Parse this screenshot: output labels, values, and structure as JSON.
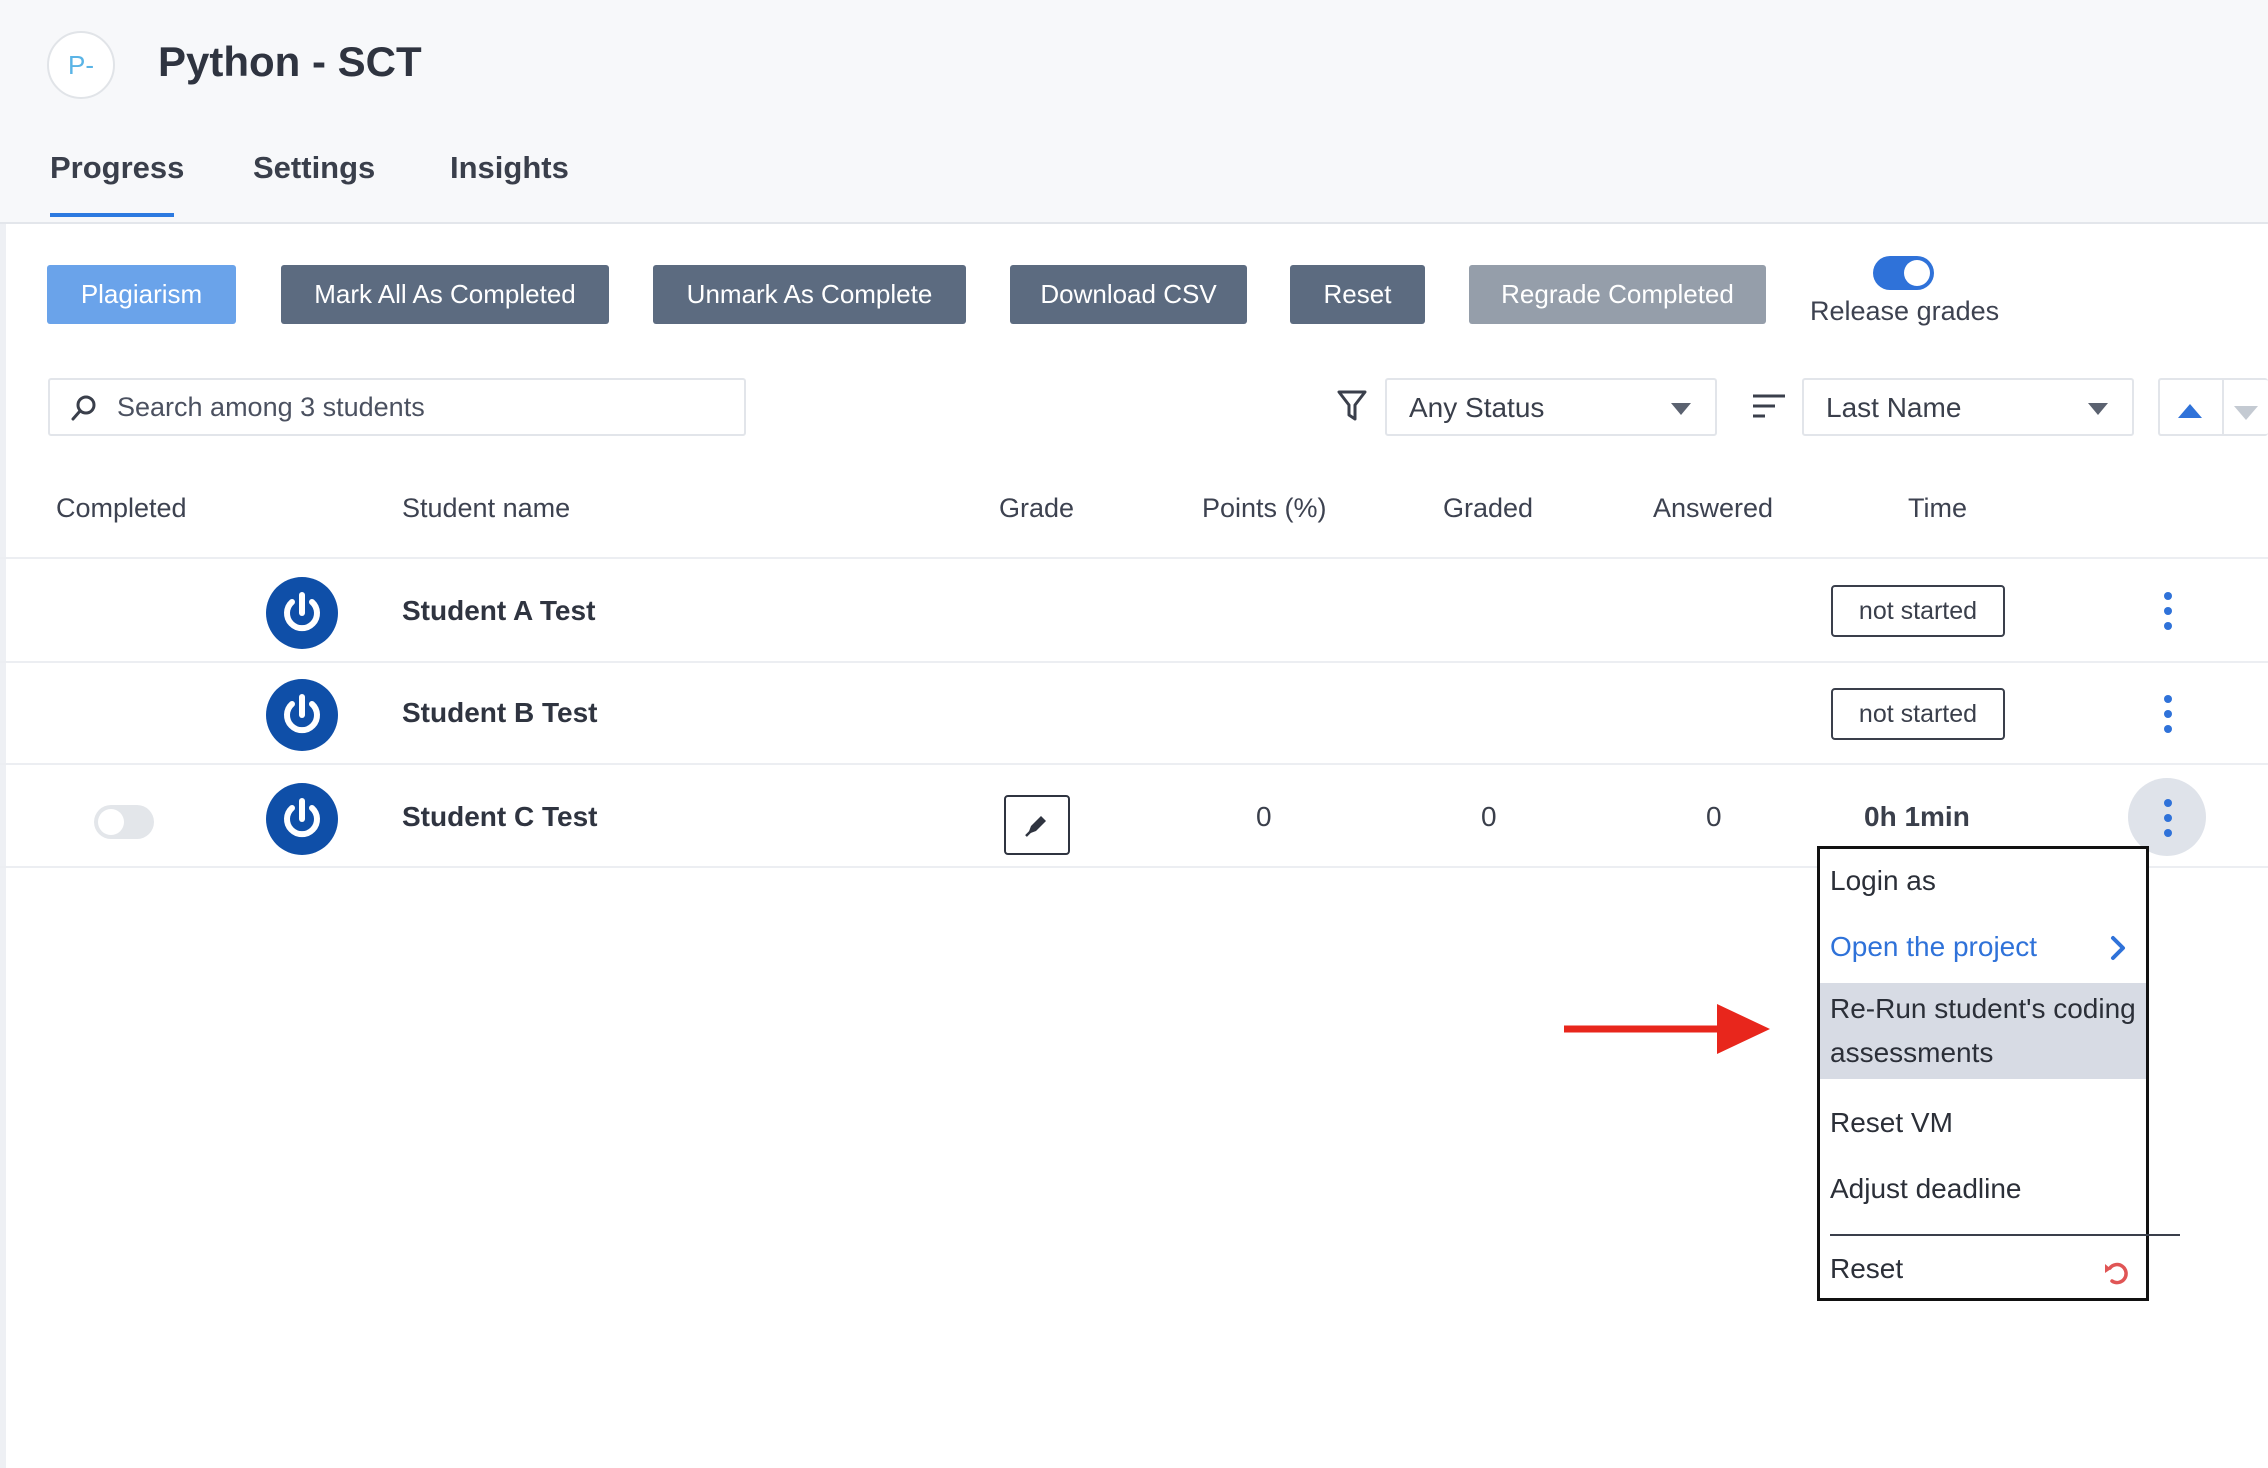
{
  "project": {
    "avatar_text": "P-",
    "title": "Python - SCT"
  },
  "tabs": [
    {
      "label": "Progress",
      "active": true
    },
    {
      "label": "Settings",
      "active": false
    },
    {
      "label": "Insights",
      "active": false
    }
  ],
  "toolbar": {
    "plagiarism": "Plagiarism",
    "mark_all": "Mark All As Completed",
    "unmark": "Unmark As Complete",
    "download_csv": "Download CSV",
    "reset": "Reset",
    "regrade": "Regrade Completed",
    "release_grades_label": "Release grades",
    "release_grades_on": true
  },
  "filters": {
    "search_placeholder": "Search among 3 students",
    "status_value": "Any Status",
    "sort_value": "Last Name"
  },
  "columns": {
    "completed": "Completed",
    "student_name": "Student name",
    "grade": "Grade",
    "points": "Points (%)",
    "graded": "Graded",
    "answered": "Answered",
    "time": "Time"
  },
  "students": [
    {
      "name": "Student A Test",
      "time": "not started"
    },
    {
      "name": "Student B Test",
      "time": "not started"
    },
    {
      "name": "Student C Test",
      "points": "0",
      "graded": "0",
      "answered": "0",
      "time": "0h 1min",
      "completed": false
    }
  ],
  "context_menu": {
    "login_as": "Login as",
    "open_project": "Open the project",
    "rerun": "Re-Run student's coding assessments",
    "reset_vm": "Reset VM",
    "adjust_deadline": "Adjust deadline",
    "reset": "Reset"
  },
  "colors": {
    "accent": "#2f72d9",
    "button_dark": "#5c6b80",
    "button_light": "#6aa3ea",
    "button_grey": "#959eaa",
    "annotation_arrow": "#e8261c",
    "student_avatar": "#0f4fa8"
  },
  "icons": [
    "search-icon",
    "filter-icon",
    "sort-lines-icon",
    "power-icon",
    "edit-icon",
    "kebab-menu-icon",
    "chevron-right-icon",
    "undo-icon",
    "red-arrow-annotation"
  ]
}
